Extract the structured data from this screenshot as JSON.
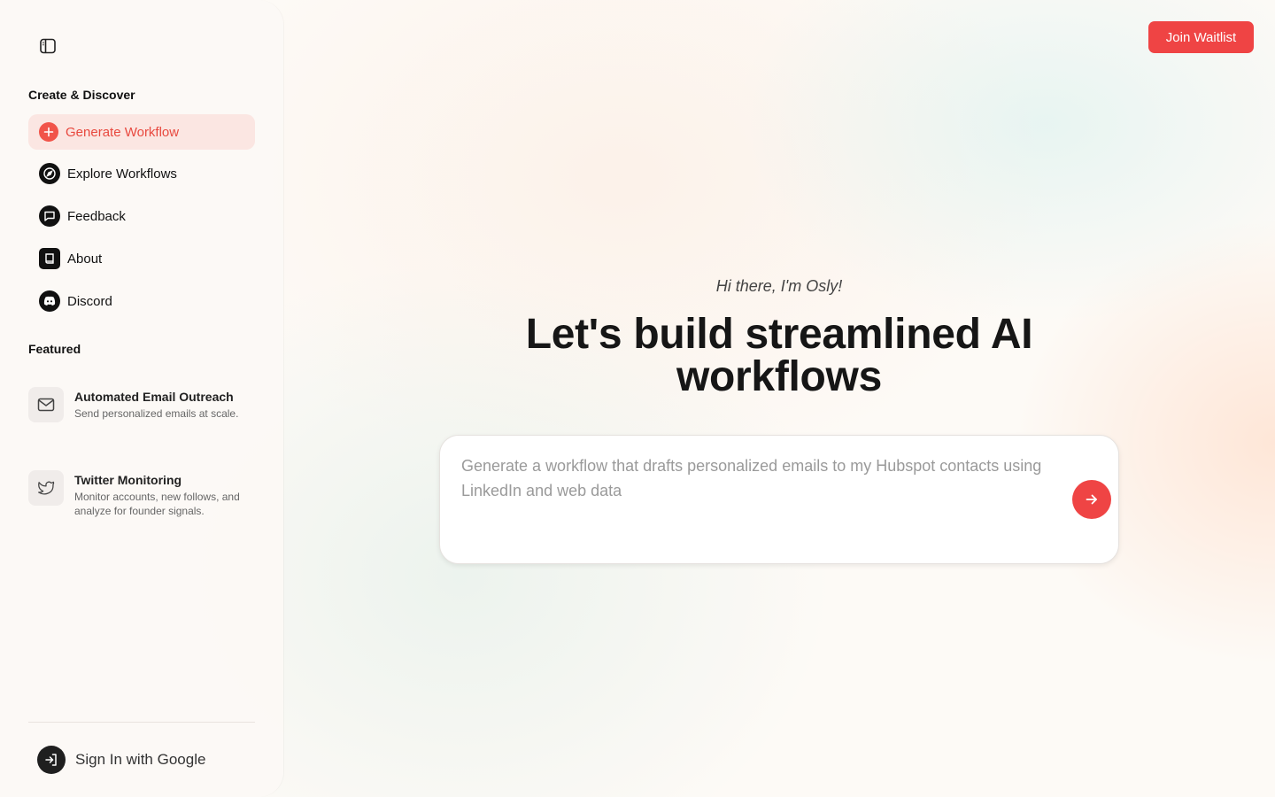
{
  "sidebar": {
    "create_title": "Create & Discover",
    "nav": [
      {
        "label": "Generate Workflow",
        "icon": "plus-icon"
      },
      {
        "label": "Explore Workflows",
        "icon": "compass-icon"
      },
      {
        "label": "Feedback",
        "icon": "chat-icon"
      },
      {
        "label": "About",
        "icon": "book-icon"
      },
      {
        "label": "Discord",
        "icon": "discord-icon"
      }
    ],
    "featured_title": "Featured",
    "featured": [
      {
        "title": "Automated Email Outreach",
        "desc": "Send personalized emails at scale.",
        "icon": "mail-icon"
      },
      {
        "title": "Twitter Monitoring",
        "desc": "Monitor accounts, new follows, and analyze for founder signals.",
        "icon": "twitter-icon"
      }
    ],
    "signin_label": "Sign In with Google"
  },
  "header": {
    "waitlist_label": "Join Waitlist"
  },
  "main": {
    "greeting": "Hi there, I'm Osly!",
    "headline": "Let's build streamlined AI workflows",
    "prompt_placeholder": "Generate a workflow that drafts personalized emails to my Hubspot contacts using LinkedIn and web data"
  },
  "colors": {
    "accent": "#ef4444",
    "active_bg": "#fbe6e2"
  }
}
